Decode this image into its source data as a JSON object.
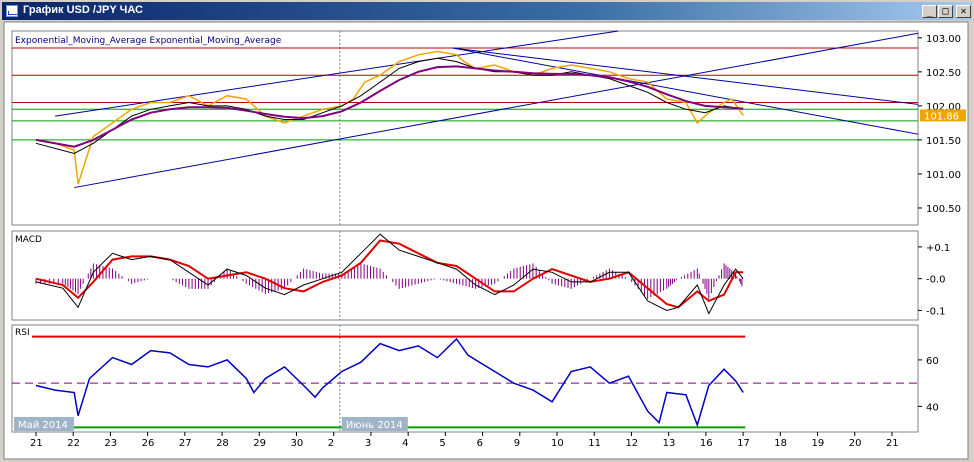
{
  "window": {
    "title": "График USD /JPY ЧАС",
    "minimize_glyph": "_",
    "maximize_glyph": "□",
    "close_glyph": "✕"
  },
  "colors": {
    "price": "#f0a500",
    "ema_fast": "#000000",
    "ema_slow": "#800080",
    "trendline": "#0000a0",
    "hline_red": "#c00000",
    "hline_green": "#00a000",
    "macd_line": "#000000",
    "macd_signal": "#e00000",
    "macd_hist": "#800080",
    "rsi_line": "#0000c0",
    "rsi_mid": "#800080",
    "rsi_high": "#e00000",
    "rsi_low": "#00a000",
    "price_badge": "#f0a500"
  },
  "chart_data": [
    {
      "type": "line",
      "panel": "price",
      "title": "Exponential_Moving_Average Exponential_Moving_Average",
      "ylim": [
        100.25,
        103.1
      ],
      "y_ticks": [
        {
          "value": 103.0,
          "label": "103.00"
        },
        {
          "value": 102.5,
          "label": "102.50"
        },
        {
          "value": 102.0,
          "label": "102.00"
        },
        {
          "value": 101.5,
          "label": "101.50"
        },
        {
          "value": 101.0,
          "label": "101.00"
        },
        {
          "value": 100.5,
          "label": "100.50"
        }
      ],
      "current_price": {
        "value": 101.86,
        "label": "101.86"
      },
      "x_labels": [
        "21",
        "22",
        "23",
        "26",
        "27",
        "28",
        "29",
        "30",
        "2",
        "3",
        "4",
        "5",
        "6",
        "9",
        "10",
        "11",
        "12",
        "13",
        "16",
        "17",
        "18",
        "19",
        "20",
        "21"
      ],
      "x_range": [
        0,
        23.7
      ],
      "month_labels": [
        {
          "at": 0,
          "text": "Май 2014"
        },
        {
          "at": 8,
          "text": "Июнь 2014"
        }
      ],
      "series": [
        {
          "kind": "price",
          "x": [
            0,
            0.5,
            1,
            1.1,
            1.5,
            2,
            2.5,
            3,
            3.5,
            4,
            4.5,
            5,
            5.5,
            6,
            6.5,
            7,
            7.5,
            8,
            8.3,
            8.6,
            9,
            9.5,
            10,
            10.5,
            11,
            11.2,
            11.5,
            12,
            12.5,
            13,
            13.5,
            14,
            14.5,
            15,
            15.5,
            16,
            16.5,
            17,
            17.3,
            17.6,
            18,
            18.2,
            18.5
          ],
          "values": [
            101.5,
            101.45,
            101.35,
            100.85,
            101.55,
            101.75,
            101.95,
            102.05,
            102.05,
            102.15,
            102.0,
            102.15,
            102.1,
            101.85,
            101.75,
            101.85,
            101.95,
            102.0,
            102.1,
            102.35,
            102.45,
            102.65,
            102.75,
            102.8,
            102.75,
            102.65,
            102.55,
            102.6,
            102.5,
            102.45,
            102.55,
            102.6,
            102.55,
            102.5,
            102.4,
            102.35,
            102.1,
            102.05,
            101.75,
            101.9,
            102.05,
            102.1,
            101.86
          ]
        },
        {
          "kind": "ema_fast",
          "x": [
            0,
            1,
            1.5,
            2,
            2.5,
            3,
            3.5,
            4,
            4.5,
            5,
            5.5,
            6,
            6.5,
            7,
            7.5,
            8,
            8.5,
            9,
            9.5,
            10,
            10.5,
            11,
            11.5,
            12,
            12.5,
            13,
            13.5,
            14,
            14.5,
            15,
            15.5,
            16,
            16.5,
            17,
            17.5,
            18,
            18.5
          ],
          "values": [
            101.45,
            101.3,
            101.45,
            101.65,
            101.85,
            101.95,
            102.0,
            102.05,
            102.0,
            102.0,
            101.95,
            101.85,
            101.8,
            101.8,
            101.9,
            102.0,
            102.15,
            102.35,
            102.55,
            102.65,
            102.7,
            102.65,
            102.55,
            102.5,
            102.5,
            102.45,
            102.45,
            102.5,
            102.45,
            102.4,
            102.3,
            102.2,
            102.05,
            101.95,
            101.9,
            102.0,
            101.95
          ]
        },
        {
          "kind": "ema_slow",
          "x": [
            0,
            1,
            1.5,
            2,
            2.5,
            3,
            3.5,
            4,
            4.5,
            5,
            5.5,
            6,
            6.5,
            7,
            7.5,
            8,
            8.5,
            9,
            9.5,
            10,
            10.5,
            11,
            11.5,
            12,
            12.5,
            13,
            13.5,
            14,
            14.5,
            15,
            15.5,
            16,
            16.5,
            17,
            17.5,
            18,
            18.5
          ],
          "values": [
            101.5,
            101.4,
            101.5,
            101.65,
            101.8,
            101.9,
            101.95,
            101.98,
            101.98,
            101.97,
            101.93,
            101.88,
            101.84,
            101.82,
            101.85,
            101.92,
            102.05,
            102.22,
            102.38,
            102.5,
            102.57,
            102.58,
            102.55,
            102.52,
            102.5,
            102.48,
            102.47,
            102.47,
            102.45,
            102.42,
            102.36,
            102.28,
            102.17,
            102.07,
            102.0,
            101.98,
            101.96
          ]
        }
      ],
      "trendlines": [
        {
          "x": [
            0.5,
            17.0
          ],
          "values": [
            101.85,
            103.25
          ]
        },
        {
          "x": [
            1.0,
            23.4
          ],
          "values": [
            100.8,
            103.1
          ]
        },
        {
          "x": [
            10.9,
            23.4
          ],
          "values": [
            102.85,
            102.0
          ]
        },
        {
          "x": [
            10.9,
            23.4
          ],
          "values": [
            102.85,
            101.55
          ]
        }
      ],
      "hlines": [
        {
          "value": 102.85,
          "color_key": "hline_red"
        },
        {
          "value": 102.45,
          "color_key": "hline_red"
        },
        {
          "value": 102.05,
          "color_key": "hline_red"
        },
        {
          "value": 101.95,
          "color_key": "hline_green"
        },
        {
          "value": 101.78,
          "color_key": "hline_green"
        },
        {
          "value": 101.5,
          "color_key": "hline_green"
        }
      ]
    },
    {
      "type": "line",
      "panel": "macd",
      "title": "MACD",
      "ylim": [
        -0.13,
        0.15
      ],
      "y_ticks": [
        {
          "value": 0.1,
          "label": "+0.1"
        },
        {
          "value": 0.0,
          "label": "-0.0"
        },
        {
          "value": -0.1,
          "label": "-0.1"
        }
      ],
      "series": [
        {
          "kind": "macd",
          "x": [
            0,
            0.7,
            1.1,
            1.5,
            2,
            2.5,
            3,
            3.5,
            4,
            4.5,
            5,
            5.5,
            6,
            6.5,
            7,
            7.5,
            8,
            8.5,
            9,
            9.5,
            10,
            10.5,
            11,
            11.5,
            12,
            12.5,
            13,
            13.5,
            14,
            14.5,
            15,
            15.5,
            16,
            16.5,
            16.8,
            17.3,
            17.6,
            18,
            18.3,
            18.5
          ],
          "values": [
            -0.01,
            -0.03,
            -0.09,
            0.02,
            0.08,
            0.06,
            0.07,
            0.06,
            0.02,
            -0.02,
            0.03,
            0.01,
            -0.03,
            -0.05,
            -0.02,
            0.0,
            0.02,
            0.08,
            0.14,
            0.09,
            0.07,
            0.05,
            0.03,
            -0.02,
            -0.05,
            -0.02,
            0.03,
            0.02,
            -0.01,
            -0.01,
            0.02,
            0.02,
            -0.07,
            -0.1,
            -0.09,
            -0.02,
            -0.11,
            -0.02,
            0.03,
            0.0
          ]
        },
        {
          "kind": "signal",
          "x": [
            0,
            0.7,
            1.1,
            1.5,
            2,
            2.5,
            3,
            3.5,
            4,
            4.5,
            5,
            5.5,
            6,
            6.5,
            7,
            7.5,
            8,
            8.5,
            9,
            9.5,
            10,
            10.5,
            11,
            11.5,
            12,
            12.5,
            13,
            13.5,
            14,
            14.5,
            15,
            15.5,
            16,
            16.5,
            16.8,
            17.3,
            17.6,
            18,
            18.3,
            18.5
          ],
          "values": [
            0.0,
            -0.02,
            -0.06,
            -0.01,
            0.06,
            0.07,
            0.07,
            0.06,
            0.04,
            0.0,
            0.01,
            0.02,
            0.0,
            -0.03,
            -0.04,
            -0.01,
            0.01,
            0.05,
            0.12,
            0.11,
            0.08,
            0.05,
            0.04,
            0.0,
            -0.04,
            -0.04,
            0.0,
            0.03,
            0.01,
            -0.01,
            0.0,
            0.02,
            -0.03,
            -0.08,
            -0.09,
            -0.04,
            -0.07,
            -0.05,
            0.02,
            0.02
          ]
        }
      ]
    },
    {
      "type": "line",
      "panel": "rsi",
      "title": "RSI",
      "ylim": [
        29,
        75
      ],
      "y_ticks": [
        {
          "value": 60,
          "label": "60"
        },
        {
          "value": 40,
          "label": "40"
        }
      ],
      "levels": [
        {
          "value": 70,
          "color_key": "rsi_high"
        },
        {
          "value": 50,
          "color_key": "rsi_mid",
          "dashed": true
        },
        {
          "value": 31,
          "color_key": "rsi_low"
        }
      ],
      "series": [
        {
          "kind": "rsi",
          "x": [
            0,
            0.5,
            1,
            1.1,
            1.4,
            2,
            2.5,
            3,
            3.5,
            4,
            4.5,
            5,
            5.5,
            5.7,
            6,
            6.5,
            7,
            7.3,
            7.5,
            8,
            8.5,
            9,
            9.5,
            10,
            10.5,
            11,
            11.3,
            11.5,
            12,
            12.5,
            13,
            13.5,
            14,
            14.5,
            15,
            15.5,
            16,
            16.3,
            16.5,
            17,
            17.3,
            17.6,
            18,
            18.3,
            18.5
          ],
          "values": [
            49,
            47,
            46,
            36,
            52,
            61,
            58,
            64,
            63,
            58,
            57,
            60,
            52,
            46,
            52,
            57,
            49,
            44,
            48,
            55,
            59,
            67,
            64,
            66,
            61,
            69,
            62,
            60,
            55,
            50,
            47,
            42,
            55,
            57,
            50,
            53,
            38,
            33,
            46,
            45,
            32,
            49,
            56,
            51,
            46
          ]
        }
      ]
    }
  ]
}
